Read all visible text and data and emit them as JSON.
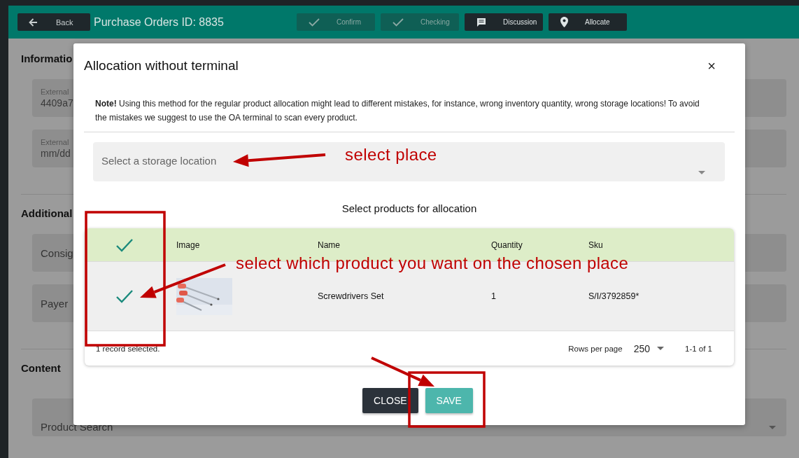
{
  "header": {
    "back": "Back",
    "title": "Purchase Orders ID: 8835",
    "actions": [
      {
        "label": "Confirm",
        "kind": "check",
        "disabled": true
      },
      {
        "label": "Checking",
        "kind": "check",
        "disabled": true
      },
      {
        "label": "Discussion",
        "kind": "comment",
        "disabled": false
      },
      {
        "label": "Allocate",
        "kind": "pin",
        "disabled": false
      }
    ]
  },
  "sections": [
    {
      "title": "Informatio",
      "fields": [
        {
          "label": "External",
          "value": "4409a7"
        },
        {
          "label": "External",
          "value": "mm/dd"
        }
      ]
    },
    {
      "title": "Additional",
      "fields": [
        {
          "placeholder": "Consig"
        },
        {
          "placeholder": "Payer"
        }
      ]
    },
    {
      "title": "Content",
      "fields": [
        {
          "placeholder": "Product Search",
          "dropdown": true
        }
      ]
    }
  ],
  "dialog": {
    "title": "Allocation without terminal",
    "close": "×",
    "note": "**Note!** Using this method for the regular product allocation might lead to different mistakes, for instance, wrong inventory quantity, wrong storage locations! To avoid the mistakes we suggest to use the OA terminal to scan every product.",
    "location": {
      "placeholder": "Select a storage location"
    },
    "caption": "Select products for allocation",
    "table": {
      "all_checked": true,
      "columns": [
        "Image",
        "Name",
        "Quantity",
        "Sku"
      ],
      "rows": [
        {
          "checked": true,
          "name": "Screwdrivers Set",
          "quantity": "1",
          "sku": "S/I/3792859*"
        }
      ],
      "selected_info": "1 record selected.",
      "rows_per_page_label": "Rows per page",
      "rows_per_page": "250",
      "range": "1-1 of 1"
    },
    "buttons": [
      {
        "label": "CLOSE",
        "kind": "secondary"
      },
      {
        "label": "SAVE",
        "kind": "primary"
      }
    ]
  },
  "annotations": [
    {
      "text": "select place"
    },
    {
      "text": "select which product you want on the chosen place"
    }
  ]
}
